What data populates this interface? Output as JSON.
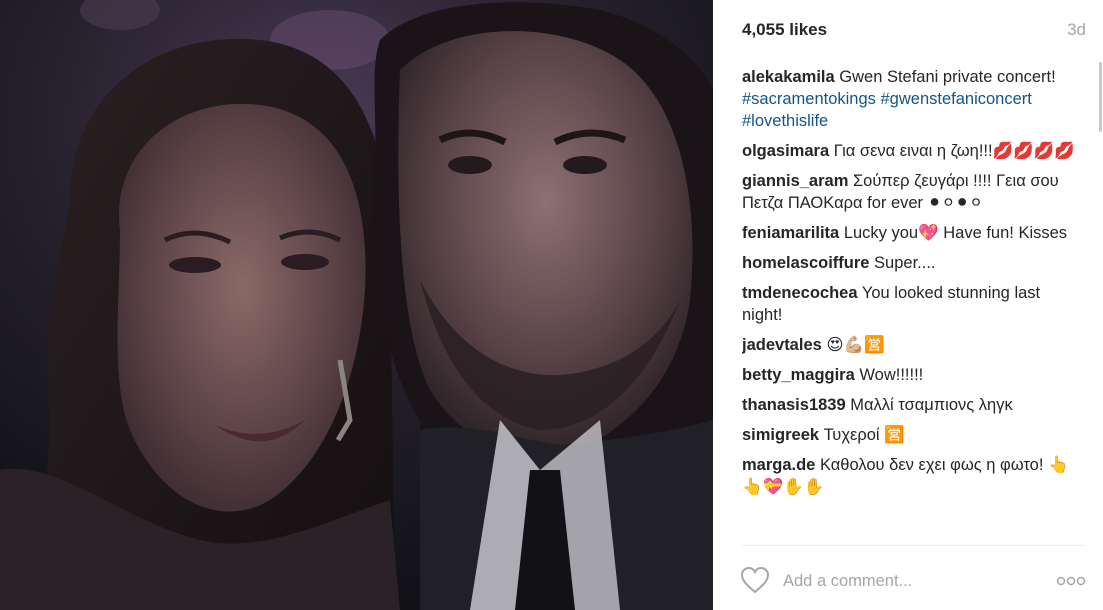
{
  "post": {
    "likes": "4,055 likes",
    "age": "3d",
    "comments": [
      {
        "user": "alekakamila",
        "text": "Gwen Stefani private concert!",
        "tags": [
          "#sacramentokings",
          "#gwenstefaniconcert",
          "#lovethislife"
        ]
      },
      {
        "user": "olgasimara",
        "text": "Για σενα ειναι η ζωη!!!💋💋💋💋"
      },
      {
        "user": "giannis_aram",
        "text": "Σούπερ ζευγάρι !!!! Γεια σου Πετζα ΠΑΟΚαρα for ever ⚫⚪⚫⚪"
      },
      {
        "user": "feniamarilita",
        "text": "Lucky you💖 Have fun! Kisses"
      },
      {
        "user": "homelascoiffure",
        "text": "Super...."
      },
      {
        "user": "tmdenecochea",
        "text": "You looked stunning last night!"
      },
      {
        "user": "jadevtales",
        "text": "😍💪🏼🈺"
      },
      {
        "user": "betty_maggira",
        "text": "Wow!!!!!!"
      },
      {
        "user": "thanasis1839",
        "text": "Μαλλί τσαμπιονς ληγκ"
      },
      {
        "user": "simigreek",
        "text": "Τυχεροί 🈺"
      },
      {
        "user": "marga.de",
        "text": "Καθολου δεν εχει φως η φωτο! 👆👆💝✋✋"
      }
    ]
  },
  "footer": {
    "comment_placeholder": "Add a comment...",
    "like_icon": "heart-outline-icon",
    "more_icon": "ellipsis-icon"
  },
  "colors": {
    "hashtag": "#125688",
    "muted": "#a6a6a6",
    "text": "#262626"
  }
}
